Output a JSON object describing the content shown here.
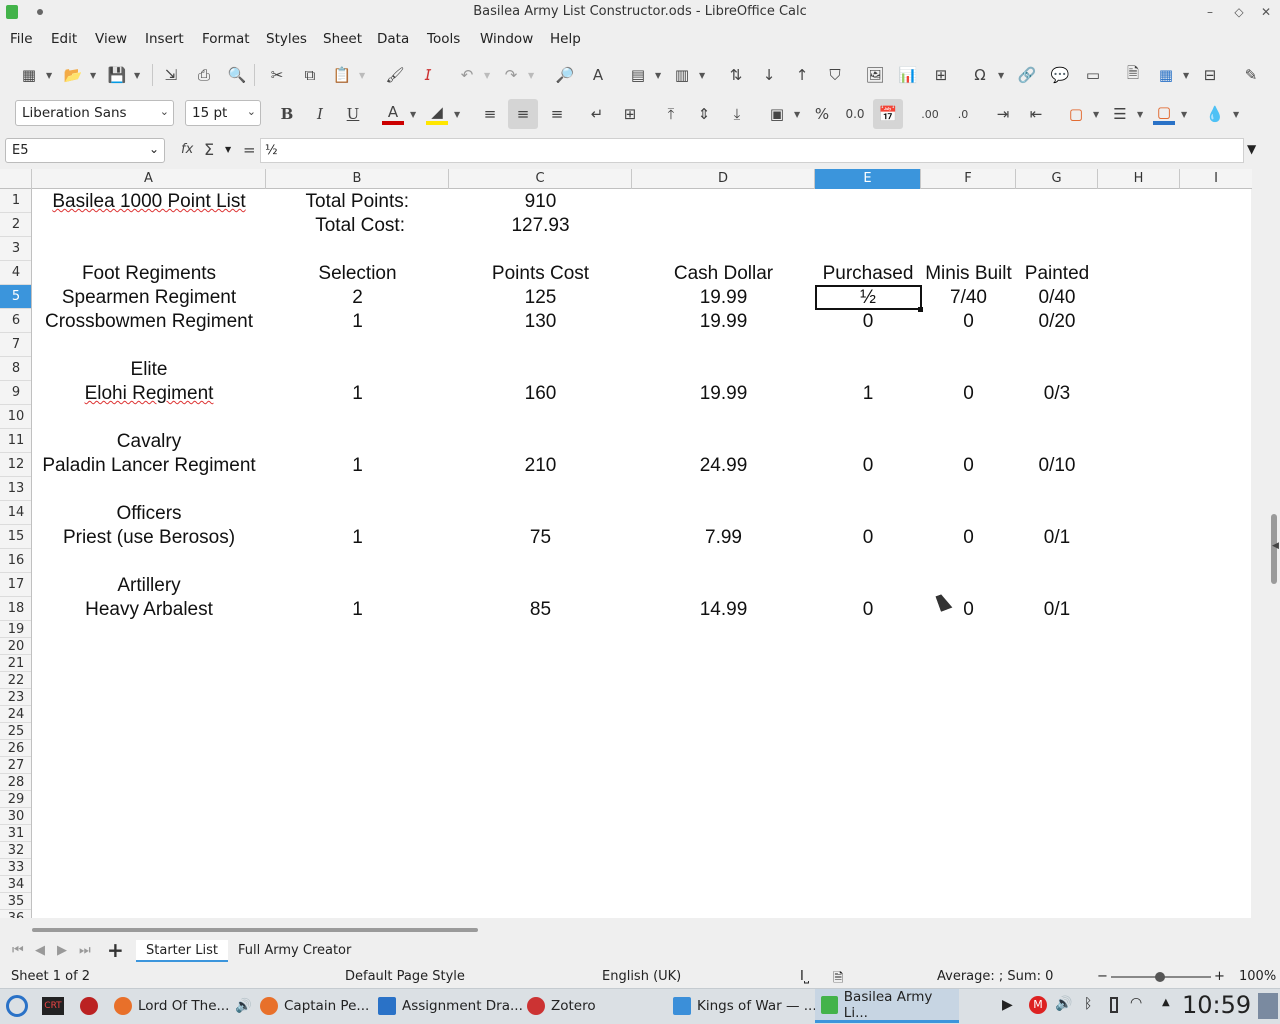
{
  "window": {
    "title": "Basilea Army List Constructor.ods - LibreOffice Calc",
    "app_icon": "calc-icon",
    "controls": [
      "minimize-icon",
      "restore-icon",
      "close-icon"
    ]
  },
  "menu": [
    "File",
    "Edit",
    "View",
    "Insert",
    "Format",
    "Styles",
    "Sheet",
    "Data",
    "Tools",
    "Window",
    "Help"
  ],
  "format_toolbar": {
    "font_name": "Liberation Sans",
    "font_size": "15 pt",
    "bold": "B",
    "italic": "I",
    "underline": "U",
    "percent": "%",
    "font_color": "#cc0000",
    "highlight_color": "#ffe600"
  },
  "formula_bar": {
    "name_box": "E5",
    "function_wizard": "fx",
    "sum": "Σ",
    "equals": "=",
    "content": "½"
  },
  "columns": [
    "A",
    "B",
    "C",
    "D",
    "E",
    "F",
    "G",
    "H",
    "I"
  ],
  "selected_column": "E",
  "rows": [
    "1",
    "2",
    "3",
    "4",
    "5",
    "6",
    "7",
    "8",
    "9",
    "10",
    "11",
    "12",
    "13",
    "14",
    "15",
    "16",
    "17",
    "18",
    "19",
    "20",
    "21",
    "22",
    "23",
    "24",
    "25",
    "26",
    "27",
    "28",
    "29",
    "30",
    "31",
    "32",
    "33",
    "34",
    "35",
    "36"
  ],
  "selected_row": "5",
  "sheet": {
    "r1": {
      "a": "Basilea 1000 Point List",
      "b": "Total Points:",
      "c": "910"
    },
    "r2": {
      "b": "Total Cost:",
      "c": "127.93"
    },
    "r4": {
      "a": "Foot Regiments",
      "b": "Selection",
      "c": "Points Cost",
      "d": "Cash Dollar",
      "e": "Purchased",
      "f": "Minis Built",
      "g": "Painted"
    },
    "r5": {
      "a": "Spearmen Regiment",
      "b": "2",
      "c": "125",
      "d": "19.99",
      "e": "½",
      "f": "7/40",
      "g": "0/40"
    },
    "r6": {
      "a": "Crossbowmen Regiment",
      "b": "1",
      "c": "130",
      "d": "19.99",
      "e": "0",
      "f": "0",
      "g": "0/20"
    },
    "r8": {
      "a": "Elite"
    },
    "r9": {
      "a": "Elohi Regiment",
      "b": "1",
      "c": "160",
      "d": "19.99",
      "e": "1",
      "f": "0",
      "g": "0/3"
    },
    "r11": {
      "a": "Cavalry"
    },
    "r12": {
      "a": "Paladin Lancer Regiment",
      "b": "1",
      "c": "210",
      "d": "24.99",
      "e": "0",
      "f": "0",
      "g": "0/10"
    },
    "r14": {
      "a": "Officers"
    },
    "r15": {
      "a": "Priest (use Berosos)",
      "b": "1",
      "c": "75",
      "d": "7.99",
      "e": "0",
      "f": "0",
      "g": "0/1"
    },
    "r17": {
      "a": "Artillery"
    },
    "r18": {
      "a": "Heavy Arbalest",
      "b": "1",
      "c": "85",
      "d": "14.99",
      "e": "0",
      "f": "0",
      "g": "0/1"
    }
  },
  "tabs": [
    "Starter List",
    "Full Army Creator"
  ],
  "active_tab": "Starter List",
  "status": {
    "sheet": "Sheet 1 of 2",
    "page_style": "Default Page Style",
    "language": "English (UK)",
    "summary": "Average: ; Sum: 0",
    "zoom": "100%"
  },
  "taskbar": {
    "tasks": [
      "Lord Of The...",
      "Captain Pe...",
      "Assignment Dra...",
      "Zotero",
      "Kings of War — ...",
      "Basilea Army Li..."
    ],
    "clock": "10:59"
  }
}
